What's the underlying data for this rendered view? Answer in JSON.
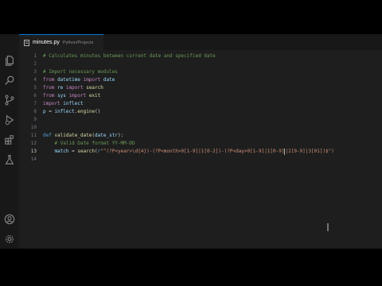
{
  "editor": {
    "tab": {
      "filename": "minutes.py",
      "path": "Python/Projects"
    },
    "activity_icons": [
      "files-icon",
      "search-icon",
      "source-control-icon",
      "run-debug-icon",
      "extensions-icon",
      "testing-icon",
      "account-icon",
      "settings-gear-icon"
    ],
    "active_line": 13,
    "lines": [
      {
        "num": "1",
        "tokens": [
          {
            "t": "# Calculates minutes between current date and specified date",
            "c": "c"
          }
        ]
      },
      {
        "num": "2",
        "tokens": []
      },
      {
        "num": "3",
        "tokens": [
          {
            "t": "# Import necessary modules",
            "c": "c"
          }
        ]
      },
      {
        "num": "4",
        "tokens": [
          {
            "t": "from ",
            "c": "k"
          },
          {
            "t": "datetime ",
            "c": "v"
          },
          {
            "t": "import ",
            "c": "k"
          },
          {
            "t": "date",
            "c": "v"
          }
        ]
      },
      {
        "num": "5",
        "tokens": [
          {
            "t": "from ",
            "c": "k"
          },
          {
            "t": "re ",
            "c": "v"
          },
          {
            "t": "import ",
            "c": "k"
          },
          {
            "t": "search",
            "c": "f"
          }
        ]
      },
      {
        "num": "6",
        "tokens": [
          {
            "t": "from ",
            "c": "k"
          },
          {
            "t": "sys ",
            "c": "v"
          },
          {
            "t": "import ",
            "c": "k"
          },
          {
            "t": "exit",
            "c": "f"
          }
        ]
      },
      {
        "num": "7",
        "tokens": [
          {
            "t": "import ",
            "c": "k"
          },
          {
            "t": "inflect",
            "c": "v"
          }
        ]
      },
      {
        "num": "8",
        "tokens": [
          {
            "t": "p ",
            "c": "v"
          },
          {
            "t": "= ",
            "c": "p"
          },
          {
            "t": "inflect",
            "c": "v"
          },
          {
            "t": ".",
            "c": "p"
          },
          {
            "t": "engine",
            "c": "f"
          },
          {
            "t": "()",
            "c": "p"
          }
        ]
      },
      {
        "num": "9",
        "tokens": []
      },
      {
        "num": "10",
        "tokens": []
      },
      {
        "num": "11",
        "tokens": [
          {
            "t": "def ",
            "c": "d"
          },
          {
            "t": "validate_date",
            "c": "f"
          },
          {
            "t": "(",
            "c": "p"
          },
          {
            "t": "date_str",
            "c": "v"
          },
          {
            "t": "):",
            "c": "p"
          }
        ]
      },
      {
        "num": "12",
        "tokens": [
          {
            "t": "    # Valid Date format YY-MM-DD",
            "c": "c"
          }
        ]
      },
      {
        "num": "13",
        "tokens": [
          {
            "t": "    match ",
            "c": "v"
          },
          {
            "t": "= ",
            "c": "p"
          },
          {
            "t": "search",
            "c": "f"
          },
          {
            "t": "(",
            "c": "p"
          },
          {
            "t": "r",
            "c": "d"
          },
          {
            "t": "\"^(?P<year>\\d{4})-(?P<month>0[1-9]|1[0-2])-(?P<day>0[1-9]|1[0-9]",
            "c": "s"
          },
          {
            "t": "CARET",
            "c": "caret"
          },
          {
            "t": "|2[0-9]|3[01])$\")",
            "c": "s"
          }
        ]
      },
      {
        "num": "14",
        "tokens": []
      }
    ]
  }
}
